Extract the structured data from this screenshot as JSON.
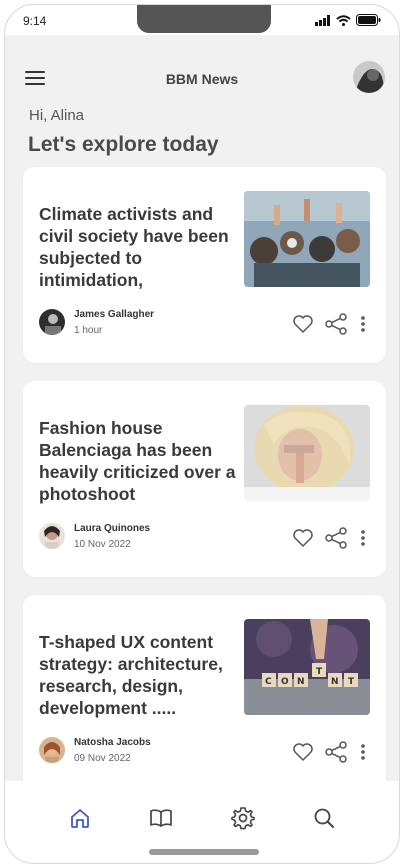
{
  "status_bar": {
    "time": "9:14"
  },
  "header": {
    "title": "BBM News",
    "menu_icon": "hamburger-menu-icon",
    "profile_avatar": "profile-avatar"
  },
  "greeting": "Hi, Alina",
  "headline": "Let's explore today",
  "articles": [
    {
      "title": "Climate activists and civil society have been subjected to intimidation,",
      "author": "James Gallagher",
      "time": "1 hour",
      "image": "protest-crowd-photo"
    },
    {
      "title": "Fashion house Balenciaga has been heavily criticized over a photoshoot",
      "author": "Laura Quinones",
      "time": "10 Nov 2022",
      "image": "blonde-woman-photo"
    },
    {
      "title": "T-shaped UX content strategy: architecture, research, design, development .....",
      "author": "Natosha Jacobs",
      "time": "09 Nov 2022",
      "image": "content-letter-tiles-photo"
    }
  ],
  "article_actions": [
    "heart-icon",
    "share-icon",
    "more-vertical-icon"
  ],
  "bottom_nav": [
    {
      "name": "home",
      "icon": "home-icon",
      "active": true
    },
    {
      "name": "library",
      "icon": "book-icon",
      "active": false
    },
    {
      "name": "settings",
      "icon": "gear-icon",
      "active": false
    },
    {
      "name": "search",
      "icon": "search-icon",
      "active": false
    }
  ],
  "colors": {
    "active_nav": "#3b5bbf",
    "icon_gray": "#555555",
    "background": "#f1f1f1",
    "card": "#ffffff"
  }
}
